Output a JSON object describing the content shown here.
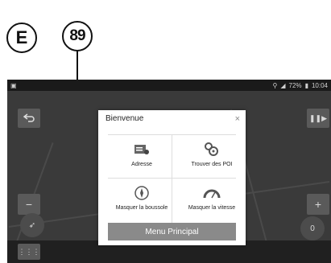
{
  "callouts": {
    "letter": "E",
    "number": "89"
  },
  "statusbar": {
    "battery": "72%",
    "time": "10:04"
  },
  "dialog": {
    "title": "Bienvenue",
    "close": "×",
    "items": [
      {
        "label": "Adresse",
        "icon": "address-icon"
      },
      {
        "label": "Trouver des POI",
        "icon": "poi-icon"
      },
      {
        "label": "Masquer la boussole",
        "icon": "compass-icon"
      },
      {
        "label": "Masquer la vitesse",
        "icon": "speedometer-icon"
      }
    ],
    "menu_button": "Menu Principal"
  },
  "colors": {
    "screen_bg": "#2b2b2b",
    "dialog_bg": "#ffffff",
    "menu_button": "#8a8a8a"
  }
}
